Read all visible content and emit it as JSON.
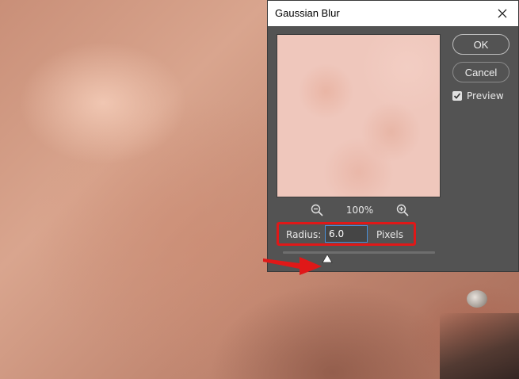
{
  "dialog": {
    "title": "Gaussian Blur",
    "zoom_level": "100%",
    "ok_label": "OK",
    "cancel_label": "Cancel",
    "preview_label": "Preview",
    "preview_checked": true,
    "radius_label": "Radius:",
    "radius_value": "6.0",
    "units_label": "Pixels",
    "slider_fraction": 0.29
  },
  "icons": {
    "close": "close-icon",
    "zoom_out": "zoom-out-icon",
    "zoom_in": "zoom-in-icon",
    "checkmark": "checkmark-icon",
    "slider_thumb": "triangle-up-thumb",
    "annotation_arrow": "red-arrow-right"
  },
  "colors": {
    "dialog_bg": "#535353",
    "annotation_red": "#e01818",
    "focus_blue": "#4a90d9"
  }
}
